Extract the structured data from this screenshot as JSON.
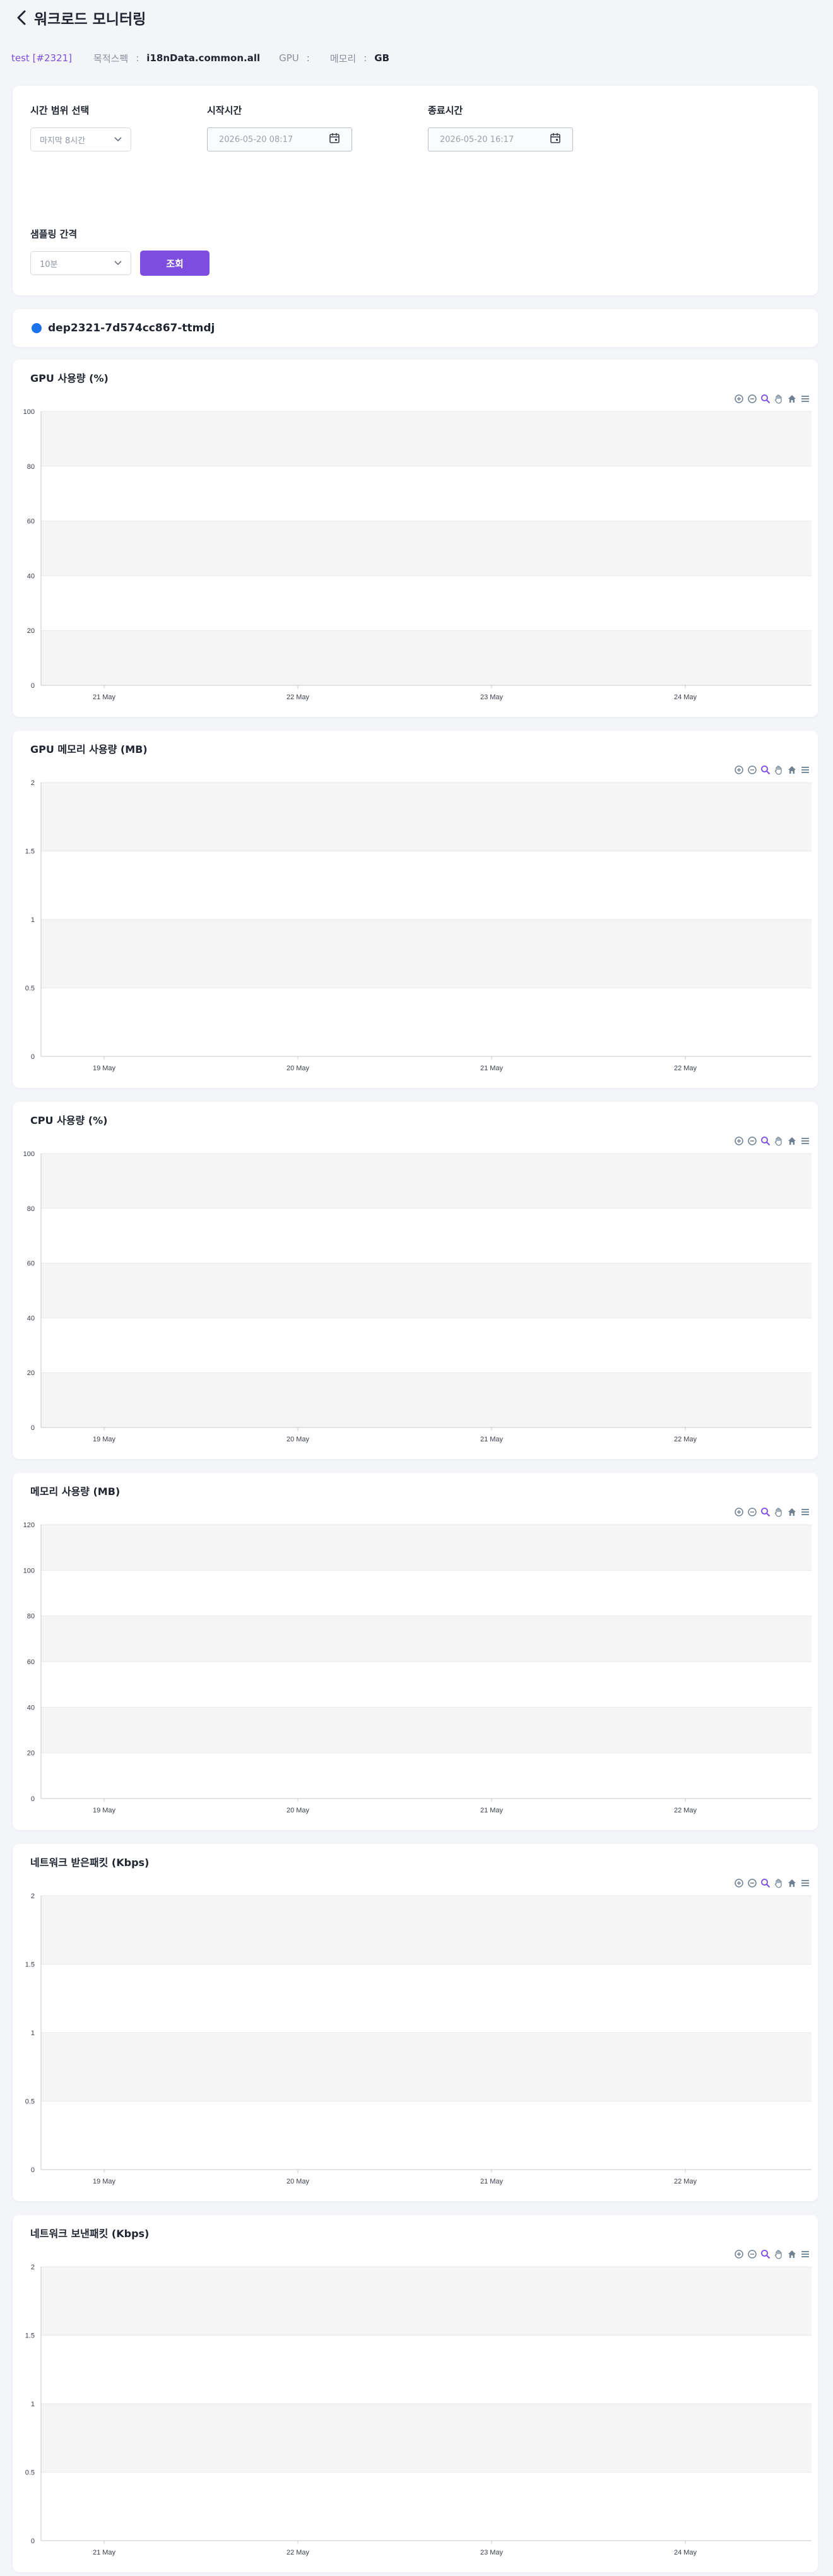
{
  "header": {
    "title": "워크로드 모니터링"
  },
  "info": {
    "project": "test [#2321]",
    "spec_label": "목적스펙",
    "spec_value": "i18nData.common.all",
    "gpu_label": "GPU",
    "gpu_value": "",
    "memory_label": "메모리",
    "memory_value": "GB",
    "colon": ":"
  },
  "filters": {
    "range_label": "시간 범위 선택",
    "range_value": "마지막 8시간",
    "start_label": "시작시간",
    "start_value": "2026-05-20 08:17",
    "end_label": "종료시간",
    "end_value": "2026-05-20 16:17",
    "interval_label": "샘플링 간격",
    "interval_value": "10분",
    "search_label": "조회"
  },
  "pod": {
    "name": "dep2321-7d574cc867-ttmdj",
    "color": "#1a73e8"
  },
  "colors": {
    "accent": "#7c4ddf",
    "band": "#f5f5f6",
    "axis": "#c4c8cf"
  },
  "toolbar_icons": [
    "zoom-in-icon",
    "zoom-out-icon",
    "zoom-select-icon",
    "pan-hand-icon",
    "home-icon",
    "menu-icon"
  ],
  "charts": [
    {
      "title": "GPU 사용량 (%)",
      "chart_data": {
        "type": "line",
        "series": [],
        "ylim": [
          0,
          100
        ],
        "yticks": [
          "0",
          "20",
          "40",
          "60",
          "80",
          "100"
        ],
        "xticks": [
          "21 May",
          "22 May",
          "23 May",
          "24 May"
        ],
        "grid": "alternating-bands"
      }
    },
    {
      "title": "GPU 메모리 사용량 (MB)",
      "chart_data": {
        "type": "line",
        "series": [],
        "ylim": [
          0,
          2
        ],
        "yticks": [
          "0",
          "0.5",
          "1",
          "1.5",
          "2"
        ],
        "xticks": [
          "19 May",
          "20 May",
          "21 May",
          "22 May"
        ],
        "grid": "alternating-bands"
      }
    },
    {
      "title": "CPU 사용량 (%)",
      "chart_data": {
        "type": "line",
        "series": [],
        "ylim": [
          0,
          100
        ],
        "yticks": [
          "0",
          "20",
          "40",
          "60",
          "80",
          "100"
        ],
        "xticks": [
          "19 May",
          "20 May",
          "21 May",
          "22 May"
        ],
        "grid": "alternating-bands"
      }
    },
    {
      "title": "메모리 사용량 (MB)",
      "chart_data": {
        "type": "line",
        "series": [],
        "ylim": [
          0,
          120
        ],
        "yticks": [
          "0",
          "20",
          "40",
          "60",
          "80",
          "100",
          "120"
        ],
        "xticks": [
          "19 May",
          "20 May",
          "21 May",
          "22 May"
        ],
        "grid": "alternating-bands"
      }
    },
    {
      "title": "네트워크 받은패킷 (Kbps)",
      "chart_data": {
        "type": "line",
        "series": [],
        "ylim": [
          0,
          2
        ],
        "yticks": [
          "0",
          "0.5",
          "1",
          "1.5",
          "2"
        ],
        "xticks": [
          "19 May",
          "20 May",
          "21 May",
          "22 May"
        ],
        "grid": "alternating-bands"
      }
    },
    {
      "title": "네트워크 보낸패킷 (Kbps)",
      "chart_data": {
        "type": "line",
        "series": [],
        "ylim": [
          0,
          2
        ],
        "yticks": [
          "0",
          "0.5",
          "1",
          "1.5",
          "2"
        ],
        "xticks": [
          "21 May",
          "22 May",
          "23 May",
          "24 May"
        ],
        "grid": "alternating-bands"
      }
    }
  ]
}
